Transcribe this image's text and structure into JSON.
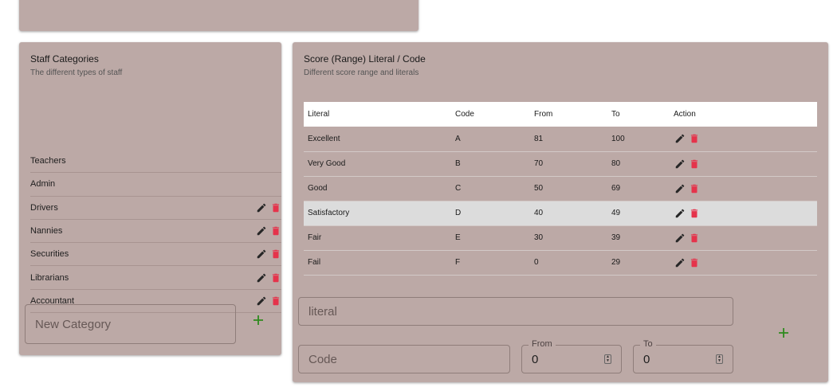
{
  "staff": {
    "title": "Staff Categories",
    "subtitle": "The different types of staff",
    "items": [
      {
        "label": "Teachers",
        "actions": false
      },
      {
        "label": "Admin",
        "actions": false
      },
      {
        "label": "Drivers",
        "actions": true
      },
      {
        "label": "Nannies",
        "actions": true
      },
      {
        "label": "Securities",
        "actions": true
      },
      {
        "label": "Librarians",
        "actions": true
      },
      {
        "label": "Accountant",
        "actions": true
      }
    ],
    "new_placeholder": "New Category"
  },
  "score": {
    "title": "Score (Range) Literal / Code",
    "subtitle": "Different score range and literals",
    "headers": [
      "Literal",
      "Code",
      "From",
      "To",
      "Action"
    ],
    "rows": [
      {
        "literal": "Excellent",
        "code": "A",
        "from": "81",
        "to": "100"
      },
      {
        "literal": "Very Good",
        "code": "B",
        "from": "70",
        "to": "80"
      },
      {
        "literal": "Good",
        "code": "C",
        "from": "50",
        "to": "69"
      },
      {
        "literal": "Satisfactory",
        "code": "D",
        "from": "40",
        "to": "49"
      },
      {
        "literal": "Fair",
        "code": "E",
        "from": "30",
        "to": "39"
      },
      {
        "literal": "Fail",
        "code": "F",
        "from": "0",
        "to": "29"
      }
    ],
    "highlighted_row": 3,
    "form": {
      "literal_placeholder": "literal",
      "code_placeholder": "Code",
      "from_label": "From",
      "from_value": "0",
      "to_label": "To",
      "to_value": "0"
    }
  },
  "colors": {
    "card": "#bca9a6",
    "edit_icon": "#262626",
    "delete_icon": "#e5334b",
    "add_icon": "#2e8b1e"
  },
  "icons": {
    "edit": "pencil-icon",
    "delete": "trash-icon",
    "add": "plus-icon"
  }
}
